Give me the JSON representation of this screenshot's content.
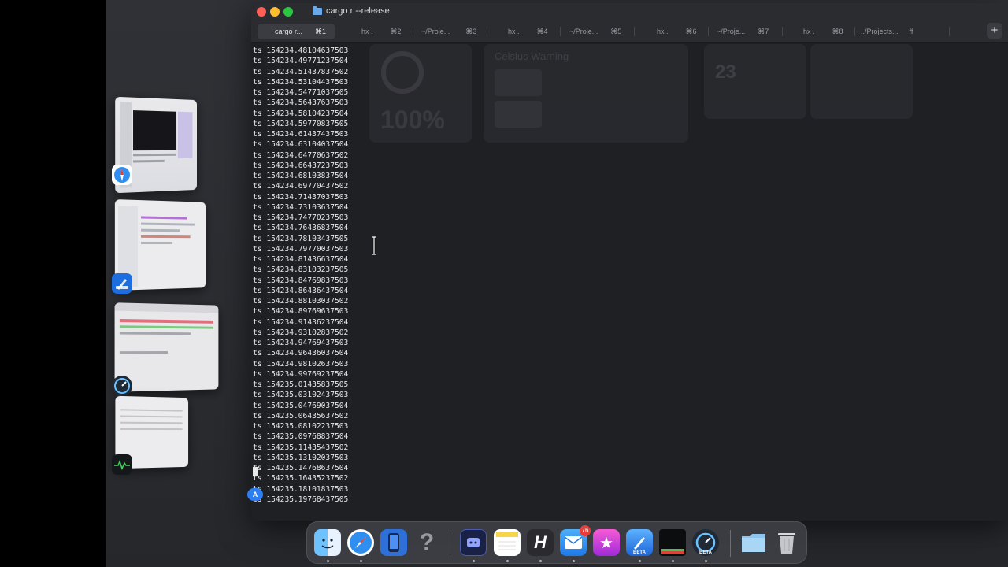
{
  "window": {
    "title": "cargo r --release"
  },
  "tabs": [
    {
      "label": "cargo r...",
      "shortcut": "⌘1",
      "active": true
    },
    {
      "label": "hx .",
      "shortcut": "⌘2",
      "active": false
    },
    {
      "label": "~/Proje...",
      "shortcut": "⌘3",
      "active": false
    },
    {
      "label": "hx .",
      "shortcut": "⌘4",
      "active": false
    },
    {
      "label": "~/Proje...",
      "shortcut": "⌘5",
      "active": false
    },
    {
      "label": "hx .",
      "shortcut": "⌘6",
      "active": false
    },
    {
      "label": "~/Proje...",
      "shortcut": "⌘7",
      "active": false
    },
    {
      "label": "hx .",
      "shortcut": "⌘8",
      "active": false
    },
    {
      "label": "../Projects...",
      "shortcut": "ff",
      "active": false
    }
  ],
  "new_tab_label": "+",
  "ghost": {
    "percent": "100%",
    "heading": "Celsius Warning",
    "number": "23"
  },
  "terminal": {
    "prefix": "ts",
    "lines": [
      "154234.48104637503",
      "154234.49771237504",
      "154234.51437837502",
      "154234.53104437503",
      "154234.54771037505",
      "154234.56437637503",
      "154234.58104237504",
      "154234.59770837505",
      "154234.61437437503",
      "154234.63104037504",
      "154234.64770637502",
      "154234.66437237503",
      "154234.68103837504",
      "154234.69770437502",
      "154234.71437037503",
      "154234.73103637504",
      "154234.74770237503",
      "154234.76436837504",
      "154234.78103437505",
      "154234.79770037503",
      "154234.81436637504",
      "154234.83103237505",
      "154234.84769837503",
      "154234.86436437504",
      "154234.88103037502",
      "154234.89769637503",
      "154234.91436237504",
      "154234.93102837502",
      "154234.94769437503",
      "154234.96436037504",
      "154234.98102637503",
      "154234.99769237504",
      "154235.01435837505",
      "154235.03102437503",
      "154235.04769037504",
      "154235.06435637502",
      "154235.08102237503",
      "154235.09768837504",
      "154235.11435437502",
      "154235.13102037503",
      "154235.14768637504",
      "154235.16435237502",
      "154235.18101837503",
      "154235.19768437505"
    ],
    "badge_letter": "A"
  },
  "stage_apps": [
    {
      "name": "safari",
      "icon": "safari-icon"
    },
    {
      "name": "xcode-beta",
      "icon": "xcode-beta-icon",
      "label": "BETA"
    },
    {
      "name": "instruments-beta",
      "icon": "instruments-icon"
    },
    {
      "name": "activity-monitor",
      "icon": "activity-monitor-icon"
    }
  ],
  "dock": {
    "items": [
      {
        "name": "finder",
        "icon": "finder-icon"
      },
      {
        "name": "safari",
        "icon": "safari-icon"
      },
      {
        "name": "simulator",
        "icon": "simulator-icon"
      },
      {
        "name": "help",
        "icon": "question-icon",
        "glyph": "?"
      },
      {
        "name": "capture",
        "icon": "capture-icon"
      },
      {
        "name": "notes",
        "icon": "notes-icon"
      },
      {
        "name": "helix",
        "icon": "helix-icon",
        "glyph": "H"
      },
      {
        "name": "mail",
        "icon": "mail-icon",
        "badge": "76"
      },
      {
        "name": "itunes-store",
        "icon": "star-icon",
        "glyph": "★"
      },
      {
        "name": "xcode",
        "icon": "xcode-icon",
        "label": "BETA"
      },
      {
        "name": "activity",
        "icon": "activity-monitor-icon"
      },
      {
        "name": "instruments",
        "icon": "instruments-icon",
        "label": "BETA"
      },
      {
        "name": "downloads",
        "icon": "folder-icon"
      },
      {
        "name": "trash",
        "icon": "trash-icon"
      }
    ]
  },
  "colors": {
    "terminal_bg": "#1f2024",
    "terminal_text": "#e8e8e8",
    "close": "#ff5f57",
    "minimize": "#febc2e",
    "zoom": "#28c840",
    "accent": "#2d7ef0"
  }
}
